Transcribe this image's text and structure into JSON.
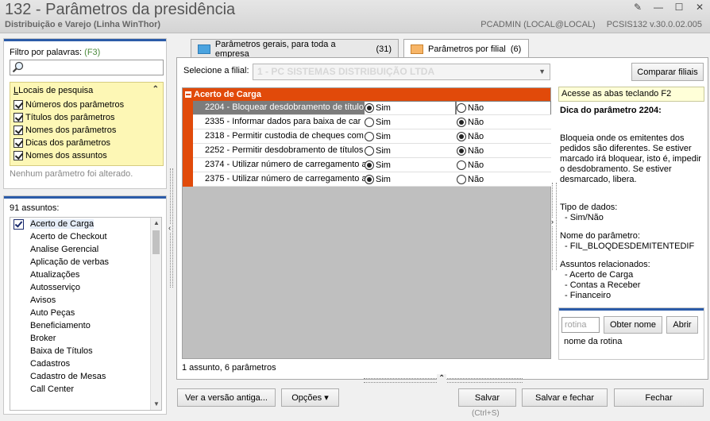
{
  "window": {
    "title": "132 - Parâmetros da presidência",
    "subtitle": "Distribuição e Varejo (Linha WinThor)",
    "user": "PCADMIN (LOCAL@LOCAL)",
    "version": "PCSIS132  v.30.0.02.005",
    "btn_edit": "✎",
    "btn_min": "—",
    "btn_max": "☐",
    "btn_close": "✕"
  },
  "filter": {
    "label": "Filtro por palavras:",
    "shortcut": "(F3)",
    "search_value": "",
    "locais_title": "Locais de pesquisa",
    "options": [
      {
        "label": "Números dos parâmetros",
        "checked": true
      },
      {
        "label": "Títulos dos parâmetros",
        "checked": true
      },
      {
        "label": "Nomes dos parâmetros",
        "checked": true
      },
      {
        "label": "Dicas dos parâmetros",
        "checked": true
      },
      {
        "label": "Nomes dos assuntos",
        "checked": true
      }
    ],
    "status": "Nenhum parâmetro foi alterado."
  },
  "assuntos": {
    "label": "91 assuntos:",
    "items": [
      "Acerto de Carga",
      "Acerto de Checkout",
      "Analise Gerencial",
      "Aplicação de verbas",
      "Atualizações",
      "Autosserviço",
      "Avisos",
      "Auto Peças",
      "Beneficiamento",
      "Broker",
      "Baixa de Títulos",
      "Cadastros",
      "Cadastro de Mesas",
      "Call Center"
    ]
  },
  "tabs": [
    {
      "label": "Parâmetros gerais, para toda a empresa",
      "count": "(31)"
    },
    {
      "label": "Parâmetros por filial",
      "count": "(6)"
    }
  ],
  "main": {
    "filial_label": "Selecione a filial:",
    "filial_value": "1 - PC SISTEMAS DISTRIBUIÇÃO LTDA",
    "compare_button": "Comparar filiais",
    "group_title": "Acerto de Carga",
    "yes_label": "Sim",
    "no_label": "Não",
    "params": [
      {
        "name": "2204 - Bloquear desdobramento de título",
        "value": "Sim"
      },
      {
        "name": "2335 - Informar dados para baixa de car",
        "value": "Não"
      },
      {
        "name": "2318 - Permitir custodia de cheques com",
        "value": "Não"
      },
      {
        "name": "2252 - Permitir desdobramento de títulos",
        "value": "Não"
      },
      {
        "name": "2374 - Utilizar número de carregamento a",
        "value": "Sim"
      },
      {
        "name": "2375 - Utilizar número de carregamento a",
        "value": "Sim"
      }
    ],
    "summary": "1 assunto, 6 parâmetros"
  },
  "tip": {
    "hint": "Acesse as abas teclando F2",
    "title": "Dica do parâmetro 2204:",
    "description": "Bloqueia onde os emitentes dos pedidos são diferentes. Se estiver marcado irá bloquear, isto é, impedir o desdobramento. Se estiver desmarcado, libera.",
    "type_label": "Tipo de dados:",
    "type_value": "- Sim/Não",
    "name_label": "Nome do parâmetro:",
    "name_value": "- FIL_BLOQDESDEMITENTEDIF",
    "related_label": "Assuntos relacionados:",
    "related": [
      "- Acerto de Carga",
      "- Contas a Receber",
      "- Financeiro"
    ]
  },
  "rotina": {
    "placeholder": "rotina",
    "obter_button": "Obter nome",
    "abrir_button": "Abrir",
    "name_label": "nome da rotina"
  },
  "footer": {
    "old_version_button": "Ver a versão antiga...",
    "options_button": "Opções",
    "save_button": "Salvar",
    "save_shortcut": "(Ctrl+S)",
    "save_close_button": "Salvar e fechar",
    "close_button": "Fechar"
  }
}
